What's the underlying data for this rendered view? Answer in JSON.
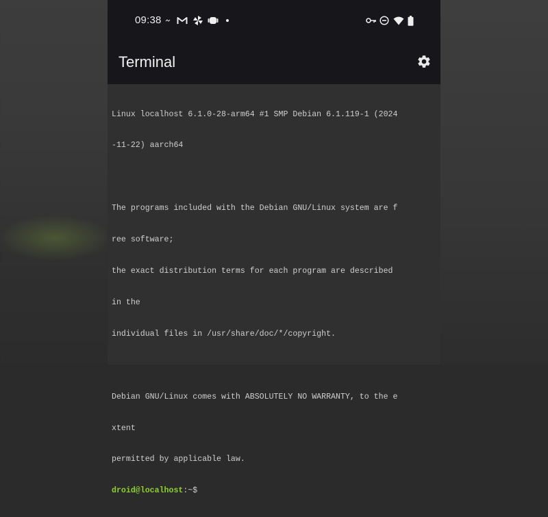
{
  "status_bar": {
    "time": "09:38",
    "icons_left": [
      "signal-small-icon",
      "gmail-icon",
      "pinwheel-icon",
      "android-icon",
      "notification-dot-icon"
    ],
    "icons_right": [
      "vpn-key-icon",
      "do-not-disturb-icon",
      "wifi-icon",
      "battery-icon"
    ]
  },
  "app_bar": {
    "title": "Terminal",
    "settings_icon": "gear-icon"
  },
  "terminal": {
    "lines": [
      "Linux localhost 6.1.0-28-arm64 #1 SMP Debian 6.1.119-1 (2024",
      "-11-22) aarch64",
      "",
      "The programs included with the Debian GNU/Linux system are f",
      "ree software;",
      "the exact distribution terms for each program are described ",
      "in the",
      "individual files in /usr/share/doc/*/copyright.",
      "",
      "Debian GNU/Linux comes with ABSOLUTELY NO WARRANTY, to the e",
      "xtent",
      "permitted by applicable law."
    ],
    "prompt_user": "droid@localhost",
    "prompt_sep": ":",
    "prompt_path": "~$"
  },
  "colors": {
    "app_bar_bg": "#17161b",
    "terminal_bg": "#303030",
    "terminal_text": "#cfcfcf",
    "prompt_user": "#8ed12f"
  }
}
